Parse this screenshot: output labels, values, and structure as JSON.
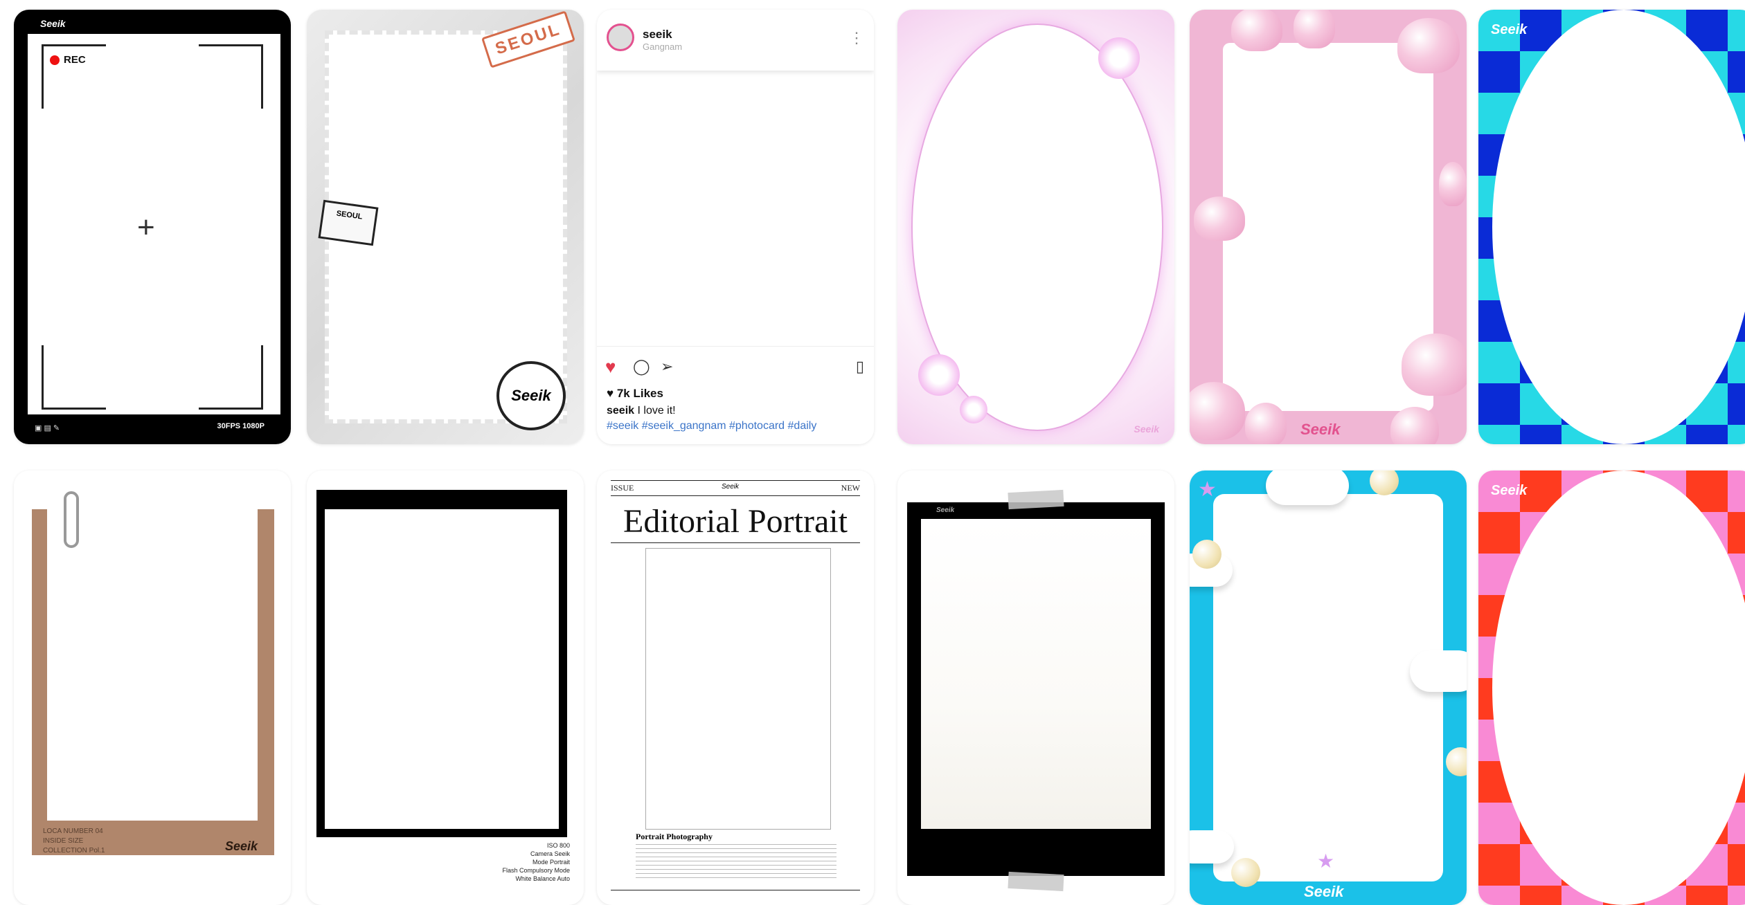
{
  "cards": [
    {
      "id": "camera",
      "brand": "Seeik",
      "rec": "REC",
      "crosshair": "+",
      "readout": "30FPS  1080P"
    },
    {
      "id": "stamp",
      "seoul": "SEOUL",
      "ticket": "SEOUL",
      "seal": "Seeik"
    },
    {
      "id": "instagram",
      "username": "seeik",
      "location": "Gangnam",
      "likes": "7k Likes",
      "caption_user": "seeik",
      "caption_text": " I love it!",
      "hashtags": "#seeik #seeik_gangnam #photocard #daily"
    },
    {
      "id": "pink-oval",
      "signature": "Seeik"
    },
    {
      "id": "pink-hearts",
      "signature": "Seeik"
    },
    {
      "id": "blue-checker",
      "logo": "Seeik"
    },
    {
      "id": "kraft",
      "lines": [
        "LOCA NUMBER  04",
        "INSIDE SIZE",
        "COLLECTION  Pol.1"
      ],
      "logo": "Seeik"
    },
    {
      "id": "film",
      "meta": [
        "ISO  800",
        "Camera  Seeik",
        "Mode  Portrait",
        "Flash  Compulsory Mode",
        "White Balance  Auto"
      ]
    },
    {
      "id": "editorial",
      "issue": "ISSUE",
      "new": "NEW",
      "brand": "Seeik",
      "masthead": "Editorial Portrait",
      "heading": "Portrait Photography"
    },
    {
      "id": "polaroid-black",
      "brand": "Seeik"
    },
    {
      "id": "cloud-frame",
      "signature": "Seeik"
    },
    {
      "id": "red-checker",
      "logo": "Seeik"
    }
  ],
  "icons": {
    "more": "more-icon",
    "heart": "heart-icon",
    "comment": "comment-icon",
    "share": "share-icon",
    "bookmark": "bookmark-icon"
  },
  "colors": {
    "ig_link": "#3b74c8",
    "heart_red": "#e23a4e",
    "rec_red": "#e11111"
  }
}
